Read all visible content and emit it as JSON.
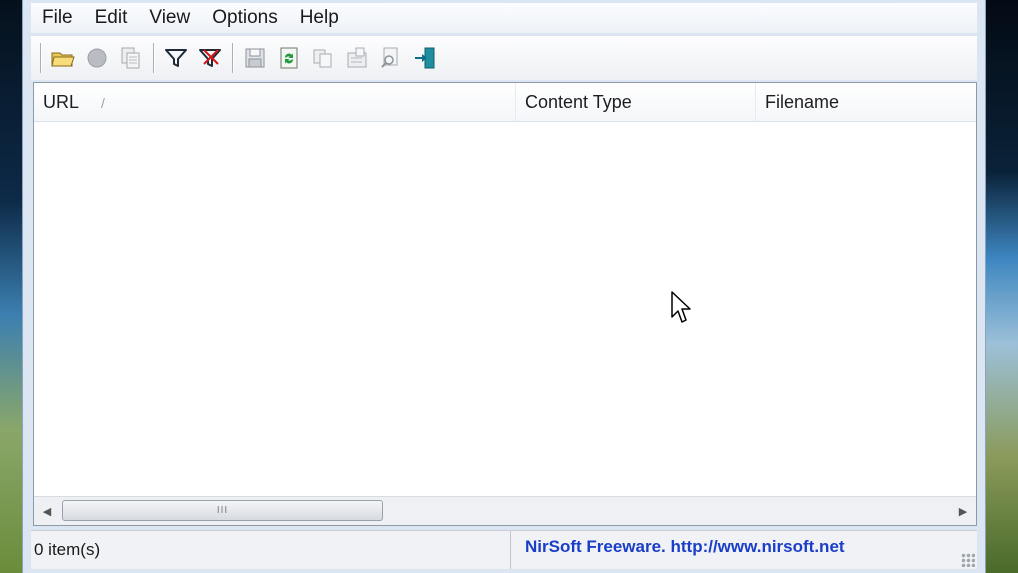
{
  "menu": {
    "items": [
      "File",
      "Edit",
      "View",
      "Options",
      "Help"
    ]
  },
  "toolbar": {
    "buttons": [
      {
        "icon": "open-folder-icon"
      },
      {
        "icon": "stop-icon"
      },
      {
        "icon": "copy-text-icon"
      },
      {
        "icon": "filter-icon"
      },
      {
        "icon": "remove-filter-icon"
      },
      {
        "icon": "save-icon"
      },
      {
        "icon": "refresh-icon"
      },
      {
        "icon": "copy-icon"
      },
      {
        "icon": "properties-icon"
      },
      {
        "icon": "find-icon"
      },
      {
        "icon": "exit-icon"
      }
    ]
  },
  "list": {
    "columns": [
      "URL",
      "Content Type",
      "Filename"
    ],
    "sort_indicator": "/",
    "rows": [],
    "scroll_grip": "III"
  },
  "status": {
    "item_count": "0 item(s)",
    "link": "NirSoft Freeware.  http://www.nirsoft.net"
  },
  "colors": {
    "link": "#1b3ec9",
    "window_bg": "#dce6f2"
  }
}
